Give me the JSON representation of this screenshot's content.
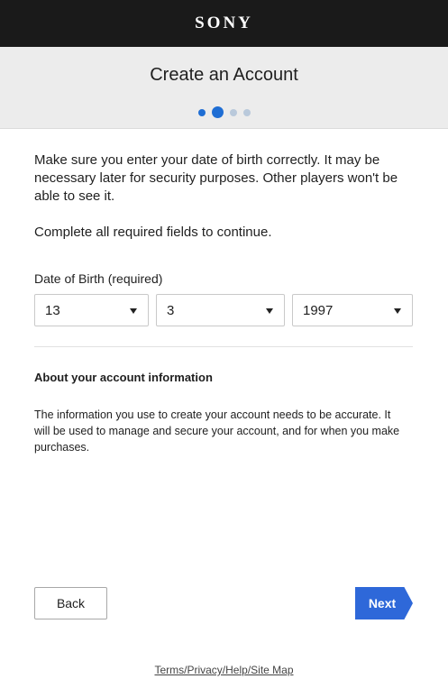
{
  "brand": {
    "logo": "SONY"
  },
  "header": {
    "title": "Create an Account",
    "steps": {
      "total": 4,
      "current": 2
    }
  },
  "content": {
    "intro": "Make sure you enter your date of birth correctly. It may be necessary later for security purposes. Other players won't be able to see it.",
    "required_note": "Complete all required fields to continue."
  },
  "dob": {
    "label": "Date of Birth (required)",
    "day": "13",
    "month": "3",
    "year": "1997"
  },
  "about": {
    "title": "About your account information",
    "text": "The information you use to create your account needs to be accurate. It will be used to manage and secure your account, and for when you make purchases."
  },
  "buttons": {
    "back": "Back",
    "next": "Next"
  },
  "footer": {
    "links": "Terms/Privacy/Help/Site Map"
  },
  "colors": {
    "accent": "#2e68d9",
    "topbar": "#1a1a1a",
    "header_bg": "#ececec"
  }
}
